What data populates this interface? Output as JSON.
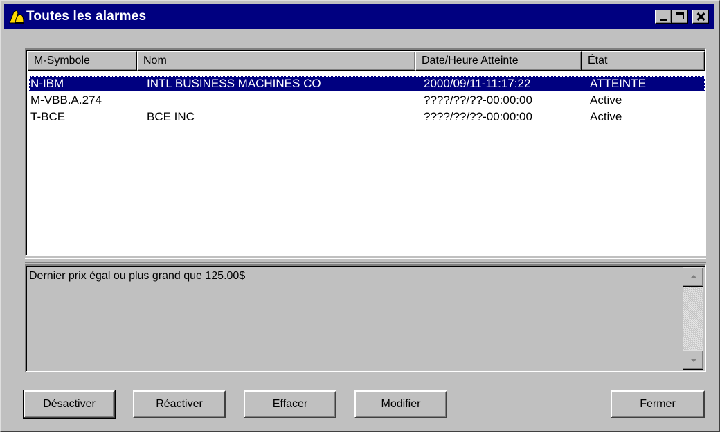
{
  "window": {
    "title": "Toutes les alarmes",
    "icon": "alarm-bell-icon",
    "controls": [
      "minimize",
      "maximize",
      "close"
    ]
  },
  "list": {
    "columns": [
      "M-Symbole",
      "Nom",
      "Date/Heure Atteinte",
      "État"
    ],
    "rows": [
      {
        "symbol": "N-IBM",
        "name": "INTL BUSINESS MACHINES CO",
        "datetime": "2000/09/11-11:17:22",
        "state": "ATTEINTE",
        "selected": true
      },
      {
        "symbol": "M-VBB.A.274",
        "name": "",
        "datetime": "????/??/??-00:00:00",
        "state": "Active",
        "selected": false
      },
      {
        "symbol": "T-BCE",
        "name": "BCE INC",
        "datetime": "????/??/??-00:00:00",
        "state": "Active",
        "selected": false
      }
    ],
    "selected_color": "#000080"
  },
  "detail": {
    "text": "Dernier prix égal ou plus grand que 125.00$"
  },
  "buttons": {
    "deactivate": {
      "mnemonic": "D",
      "rest": "ésactiver"
    },
    "reactivate": {
      "mnemonic": "R",
      "rest": "éactiver"
    },
    "erase": {
      "mnemonic": "E",
      "rest": "ffacer"
    },
    "modify": {
      "mnemonic": "M",
      "rest": "odifier"
    },
    "close": {
      "mnemonic": "F",
      "rest": "ermer"
    }
  },
  "colors": {
    "titlebar": "#000080",
    "face": "#c0c0c0"
  }
}
